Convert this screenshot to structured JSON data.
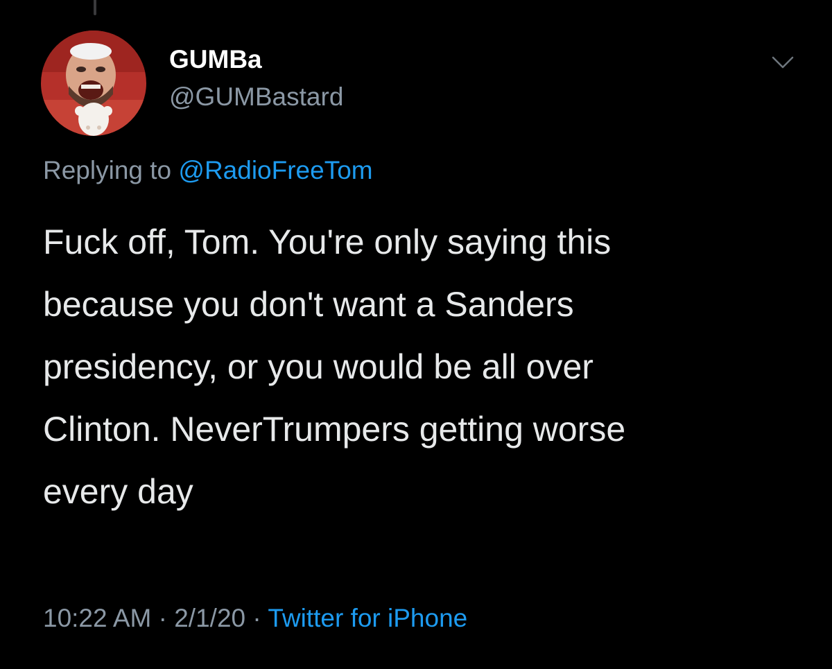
{
  "author": {
    "display_name": "GUMBa",
    "handle": "@GUMBastard"
  },
  "reply": {
    "prefix": "Replying to ",
    "target": "@RadioFreeTom"
  },
  "tweet": {
    "lines": [
      "Fuck off, Tom. You're only saying this",
      "because you don't want a Sanders",
      "presidency, or you would be all over",
      "Clinton. NeverTrumpers getting worse",
      "every day"
    ]
  },
  "meta": {
    "time": "10:22 AM",
    "separator": " · ",
    "date": "2/1/20",
    "source": "Twitter for iPhone"
  },
  "icons": {
    "menu": "chevron-down-icon",
    "avatar": "avatar"
  },
  "colors": {
    "background": "#000000",
    "primary_text": "#e7e9ea",
    "secondary_text": "#8b98a5",
    "link": "#1d9bf0"
  }
}
